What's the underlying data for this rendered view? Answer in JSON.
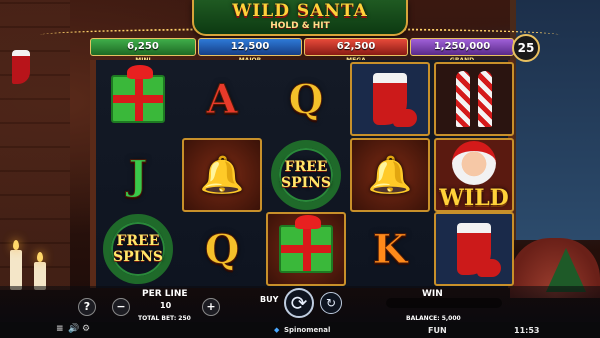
{
  "title": {
    "main": "WILD SANTA",
    "sub": "HOLD & HIT"
  },
  "jackpots": [
    {
      "name": "MINI",
      "value": "6,250"
    },
    {
      "name": "MAJOR",
      "value": "12,500"
    },
    {
      "name": "MEGA",
      "value": "62,500"
    },
    {
      "name": "GRAND",
      "value": "1,250,000"
    }
  ],
  "lines": "25",
  "reels": {
    "free_spins_line1": "FREE",
    "free_spins_line2": "SPINS",
    "wild": "WILD",
    "letters": {
      "a": "A",
      "q": "Q",
      "j": "J",
      "k": "K"
    }
  },
  "controls": {
    "help": "?",
    "per_line_label": "PER LINE",
    "per_line_value": "10",
    "minus": "−",
    "plus": "+",
    "total_bet": "TOTAL BET: 250",
    "buy": "BUY",
    "win_label": "WIN",
    "balance": "BALANCE: 5,000"
  },
  "status_bar": {
    "brand": "Spinomenal",
    "mode": "FUN",
    "time": "11:53"
  }
}
